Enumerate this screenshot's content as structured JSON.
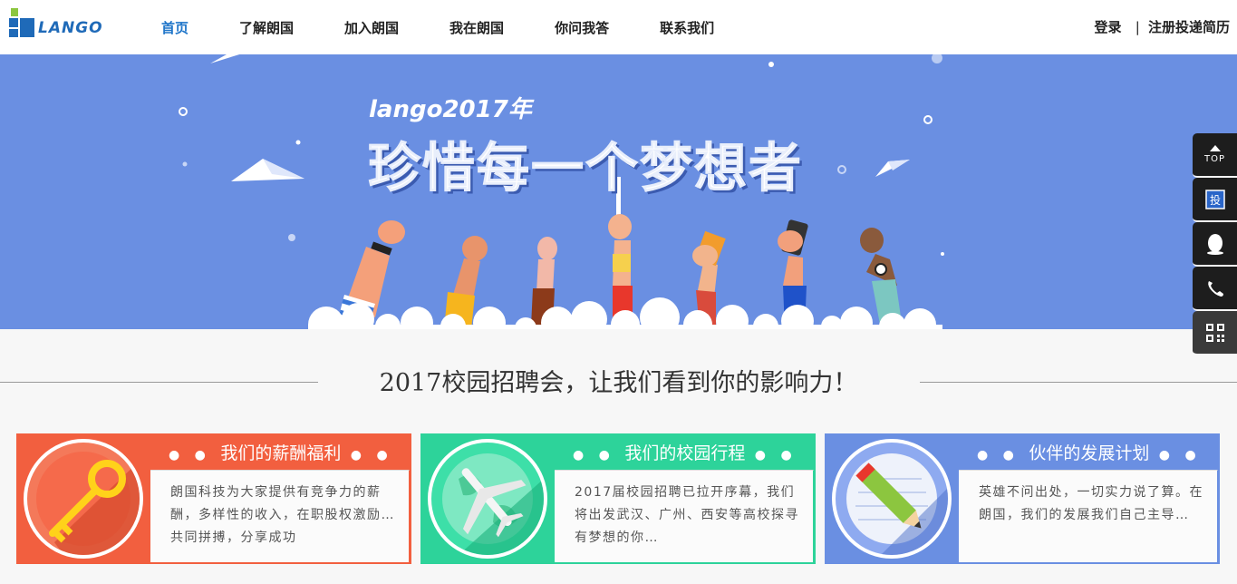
{
  "brand": {
    "logo_text": "LANGO"
  },
  "nav": {
    "items": [
      {
        "label": "首页",
        "active": true
      },
      {
        "label": "了解朗国"
      },
      {
        "label": "加入朗国"
      },
      {
        "label": "我在朗国"
      },
      {
        "label": "你问我答"
      },
      {
        "label": "联系我们"
      }
    ]
  },
  "auth": {
    "login": "登录",
    "separator": "|",
    "register": "注册投递简历"
  },
  "banner": {
    "subtitle": "lango2017年",
    "title": "珍惜每一个梦想者",
    "background": "#6a8fe2"
  },
  "sidebar": {
    "top_label": "TOP",
    "icons": [
      "arrow-up-icon",
      "resume-icon",
      "qq-icon",
      "phone-icon",
      "qrcode-icon"
    ]
  },
  "section": {
    "title": "2017校园招聘会，让我们看到你的影响力！"
  },
  "cards": [
    {
      "title": "我们的薪酬福利",
      "text": "朗国科技为大家提供有竞争力的薪酬，多样性的收入，在职股权激励…共同拼搏，分享成功",
      "color": "#f25f3f",
      "icon": "key-icon"
    },
    {
      "title": "我们的校园行程",
      "text": "2017届校园招聘已拉开序幕，我们将出发武汉、广州、西安等高校探寻有梦想的你…",
      "color": "#2dd39a",
      "icon": "airplane-globe-icon"
    },
    {
      "title": "伙伴的发展计划",
      "text": "英雄不问出处，一切实力说了算。在朗国，我们的发展我们自己主导…",
      "color": "#6a8fe2",
      "icon": "pencil-notebook-icon"
    }
  ]
}
